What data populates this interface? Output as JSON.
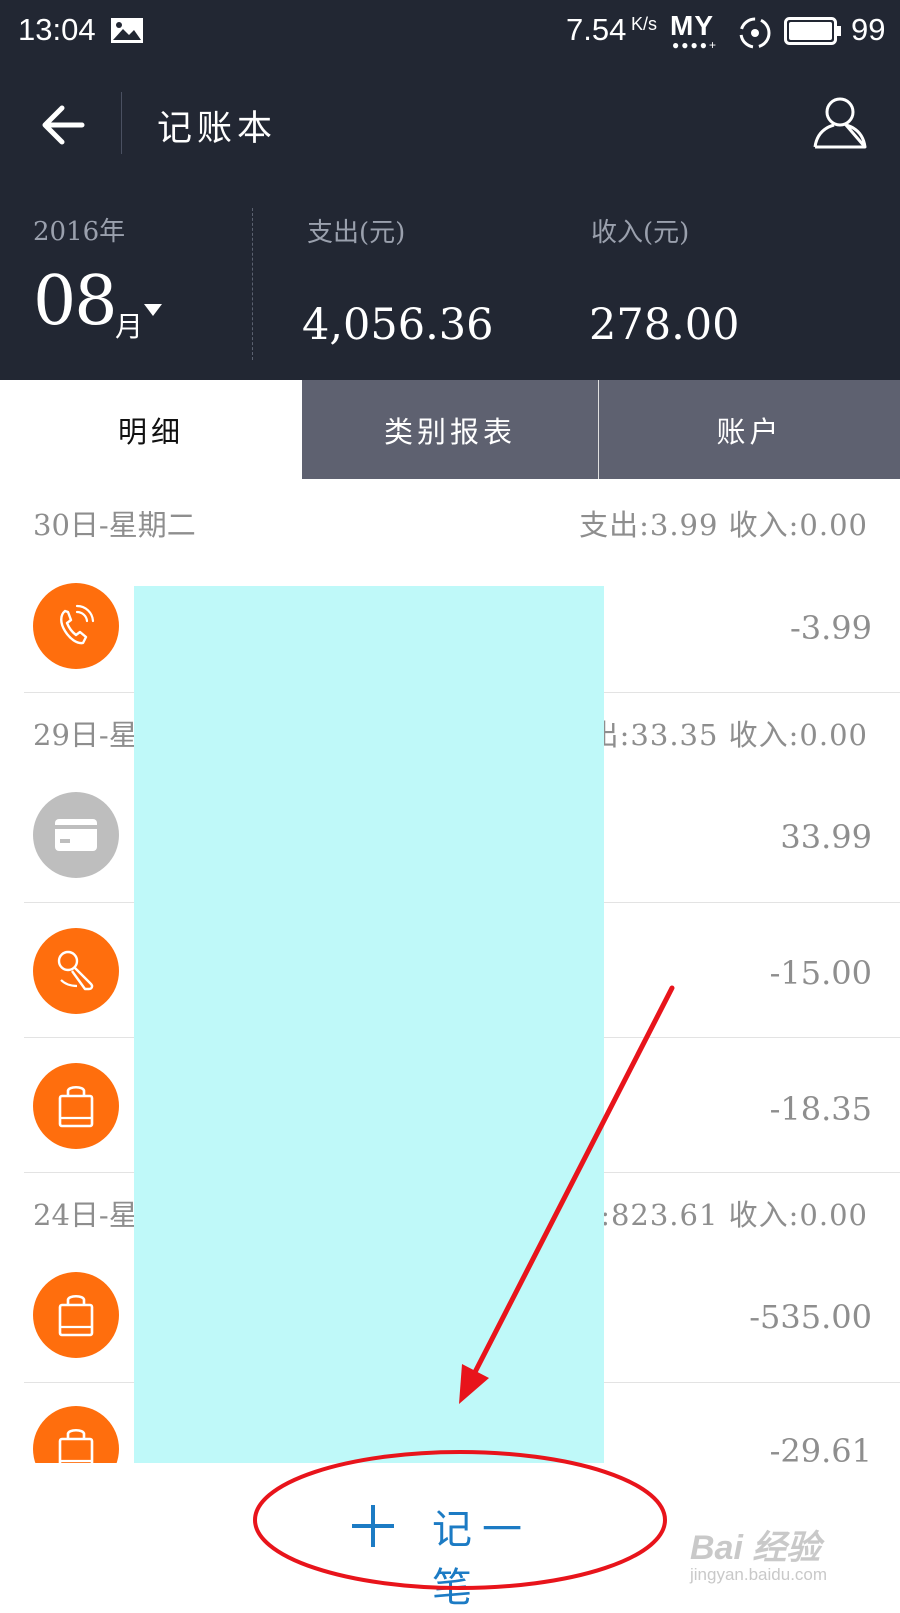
{
  "status_bar": {
    "time": "13:04",
    "network_speed": "7.54",
    "network_speed_unit": "K/s",
    "carrier": "MY",
    "battery_level": "99"
  },
  "header": {
    "title": "记账本",
    "year": "2016年",
    "month": "08",
    "month_unit": "月",
    "expense_label": "支出(元)",
    "expense_value": "4,056.36",
    "income_label": "收入(元)",
    "income_value": "278.00"
  },
  "tabs": [
    {
      "label": "明细",
      "active": true
    },
    {
      "label": "类别报表",
      "active": false
    },
    {
      "label": "账户",
      "active": false
    }
  ],
  "days": [
    {
      "date": "30日-星期二",
      "summary": "支出:3.99 收入:0.00"
    },
    {
      "date": "29日-星",
      "summary": "出:33.35 收入:0.00"
    },
    {
      "date": "24日-星",
      "summary": "出:823.61 收入:0.00"
    }
  ],
  "entries": [
    {
      "icon": "phone-icon",
      "amount": "-3.99"
    },
    {
      "icon": "card-icon",
      "amount": "33.99"
    },
    {
      "icon": "microphone-icon",
      "amount": "-15.00"
    },
    {
      "icon": "shopping-bag-icon",
      "amount": "-18.35"
    },
    {
      "icon": "shopping-bag-icon",
      "amount": "-535.00"
    },
    {
      "icon": "shopping-bag-icon",
      "amount": "-29.61"
    }
  ],
  "add_button": {
    "label": "记一笔"
  },
  "watermark": {
    "main": "Bai 经验",
    "sub": "jingyan.baidu.com"
  },
  "colors": {
    "header_bg": "#222733",
    "tab_inactive_bg": "#5e6170",
    "category_orange": "#ff6e0d",
    "category_grey": "#bebebe",
    "accent_blue": "#1c7bc4",
    "annotation_red": "#e8141b",
    "redaction": "#bff9f9"
  }
}
